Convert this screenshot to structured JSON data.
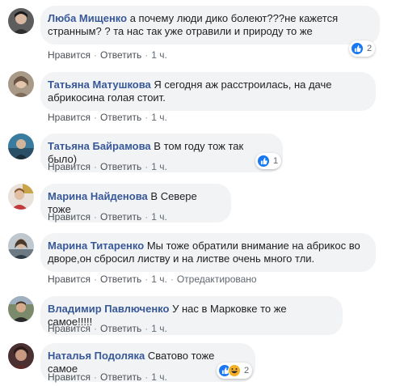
{
  "colors": {
    "author": "#385898",
    "bubble": "#f2f3f5",
    "like": "#1877f2",
    "haha": "#f7b125"
  },
  "comments": [
    {
      "author": "Люба Мищенко",
      "text": "а почему люди дико болеют???не кажется странным? ? та нас так уже отравили и природу то же",
      "like": "Нравится",
      "reply": "Ответить",
      "time": "1 ч.",
      "reactions": {
        "icons": [
          "like-icon"
        ],
        "count": "2"
      }
    },
    {
      "author": "Татьяна Матушкова",
      "text": "Я сегодня аж расстроилась, на даче абрикосина голая стоит.",
      "like": "Нравится",
      "reply": "Ответить",
      "time": "1 ч."
    },
    {
      "author": "Татьяна Байрамова",
      "text": "В том году тож так было)",
      "like": "Нравится",
      "reply": "Ответить",
      "time": "1 ч.",
      "reactions": {
        "icons": [
          "like-icon"
        ],
        "count": "1"
      }
    },
    {
      "author": "Марина Найденова",
      "text": "В Севере тоже",
      "like": "Нравится",
      "reply": "Ответить",
      "time": "1 ч."
    },
    {
      "author": "Марина Титаренко",
      "text": "Мы тоже обратили внимание на абрикос во дворе,он сбросил листву и на листве очень много тли.",
      "like": "Нравится",
      "reply": "Ответить",
      "time": "1 ч.",
      "edited": "Отредактировано"
    },
    {
      "author": "Владимир Павлюченко",
      "text": "У нас в Марковке то же самое!!!!!",
      "like": "Нравится",
      "reply": "Ответить",
      "time": "1 ч."
    },
    {
      "author": "Наталья Подоляка",
      "text": "Сватово тоже самое",
      "like": "Нравится",
      "reply": "Ответить",
      "time": "1 ч.",
      "reactions": {
        "icons": [
          "like-icon",
          "haha-icon"
        ],
        "count": "2"
      }
    }
  ]
}
